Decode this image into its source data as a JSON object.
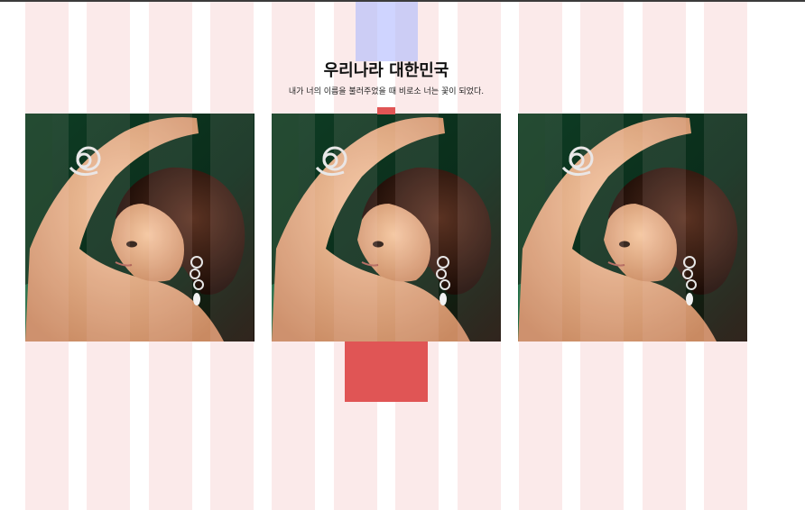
{
  "header": {
    "title": "우리나라 대한민국",
    "subtitle": "내가 너의 이름을 불러주었을 때 비로소 너는 꽃이 되었다."
  },
  "cards": [
    {
      "image": "woman-with-jewelry-photo"
    },
    {
      "image": "woman-with-jewelry-photo"
    },
    {
      "image": "woman-with-jewelry-photo"
    }
  ],
  "colors": {
    "grid_column": "#fbeaea",
    "accent_red": "#e05555",
    "accent_blue": "#cccdf5",
    "photo_background": "#0f3a22"
  }
}
